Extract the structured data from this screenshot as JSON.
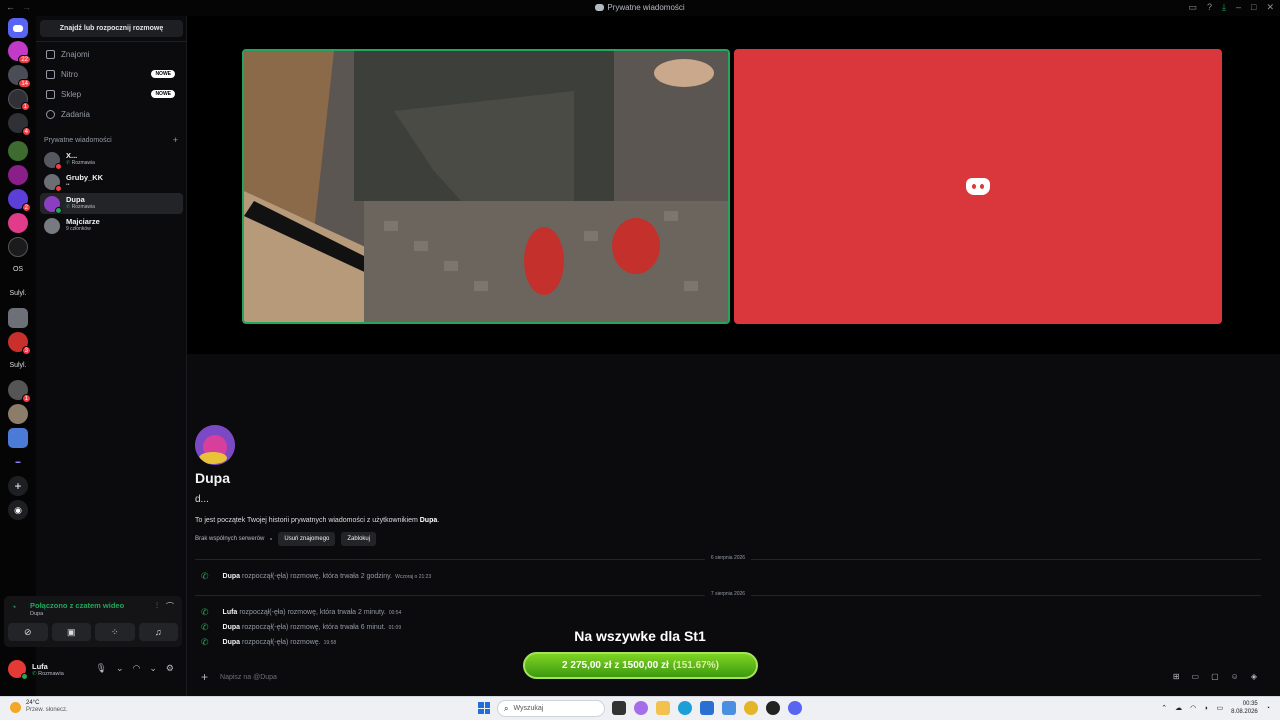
{
  "window": {
    "title": "Prywatne wiadomości"
  },
  "rail": {
    "servers": [
      {
        "icon": "discord-home-icon",
        "badge": ""
      },
      {
        "icon": "server-icon",
        "badge": "22"
      },
      {
        "icon": "server-icon",
        "badge": "14"
      },
      {
        "icon": "server-icon",
        "badge": "1"
      },
      {
        "icon": "server-icon",
        "badge": "4"
      },
      {
        "icon": "server-icon",
        "badge": ""
      },
      {
        "icon": "server-icon",
        "badge": ""
      },
      {
        "icon": "server-icon",
        "badge": "2"
      },
      {
        "icon": "server-icon",
        "badge": ""
      },
      {
        "icon": "server-icon",
        "badge": ""
      }
    ],
    "text_os": "OS",
    "text_folder1": "Sulyl.",
    "text_folder2": "Sulyl.",
    "lower_badges": {
      "b1": "3",
      "b2": "1"
    }
  },
  "sidebar": {
    "find_button": "Znajdź lub rozpocznij rozmowę",
    "nav": {
      "friends": "Znajomi",
      "nitro": "Nitro",
      "nitro_badge": "NOWE",
      "shop": "Sklep",
      "shop_badge": "NOWE",
      "quests": "Zadania"
    },
    "dm_header": "Prywatne wiadomości",
    "dms": [
      {
        "name": "X...",
        "sub": "Rozmawia"
      },
      {
        "name": "Gruby_KK",
        "sub": "••"
      },
      {
        "name": "Dupa",
        "sub": "Rozmawia"
      },
      {
        "name": "Majciarze",
        "sub": "9 członków"
      }
    ]
  },
  "voice_panel": {
    "title": "Połączono z czatem wideo",
    "subtitle": "Dupa"
  },
  "user_panel": {
    "name": "Lufa",
    "status": "Rozmawia"
  },
  "chat": {
    "profile_name": "Dupa",
    "profile_handle": "d...",
    "intro_prefix": "To jest początek Twojej historii prywatnych wiadomości z użytkownikiem ",
    "intro_name": "Dupa",
    "intro_suffix": ".",
    "no_mutual": "Brak wspólnych serwerów",
    "remove_friend": "Usuń znajomego",
    "block": "Zablokuj",
    "date1": "6 sierpnia 2026",
    "date2": "7 sierpnia 2026",
    "messages": [
      {
        "name": "Dupa",
        "text": "rozpoczął(-ęła) rozmowę, która trwała 2 godziny.",
        "time": "Wczoraj o 21:23"
      },
      {
        "name": "Lufa",
        "text": "rozpoczął(-ęła) rozmowę, która trwała 2 minuty.",
        "time": "00:54"
      },
      {
        "name": "Dupa",
        "text": "rozpoczął(-ęła) rozmowę, która trwała 6 minut.",
        "time": "01:09"
      },
      {
        "name": "Dupa",
        "text": "rozpoczął(-ęła) rozmowę.",
        "time": "19:58"
      }
    ],
    "composer_placeholder": "Napisz na @Dupa"
  },
  "overlay": {
    "title": "Na wszywke dla St1",
    "amount": "2 275,00 zł",
    "sep": "z",
    "goal": "1500,00 zł",
    "percent": "(151.67%)"
  },
  "taskbar": {
    "temp": "24°C",
    "weather": "Przew. słonecz.",
    "search": "Wyszukaj",
    "time": "00:35",
    "date": "8.08.2026"
  }
}
